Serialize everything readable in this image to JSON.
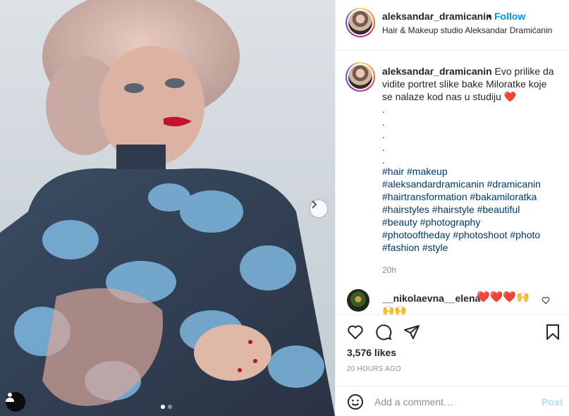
{
  "post": {
    "username": "aleksandar_dramicanin",
    "separator": "•",
    "follow_label": "Follow",
    "location": "Hair & Makeup studio Aleksandar Dramićanin",
    "caption_username": "aleksandar_dramicanin",
    "caption_text": "Evo prilike da vidite portret slike bake Miloratke koje se nalaze kod nas u studiju ❤️",
    "caption_dots": [
      ".",
      ".",
      ".",
      ".",
      "."
    ],
    "hashtags": [
      "#hair #makeup",
      "#aleksandardramicanin #dramicanin",
      "#hairtransformation #bakamiloratka",
      "#hairstyles #hairstyle #beautiful",
      "#beauty #photography",
      "#photooftheday #photoshoot #photo",
      "#fashion #style"
    ],
    "caption_time": "20h",
    "likes": "3,576 likes",
    "posted": "20 HOURS AGO"
  },
  "comment": {
    "username": "__nikolaevna__elena",
    "emojis_line1": "❤️❤️❤️🙌",
    "emojis_line2": "🙌🙌"
  },
  "composer": {
    "placeholder": "Add a comment…",
    "post_label": "Post"
  },
  "icons": [
    "next-arrow-icon",
    "user-tag-icon",
    "heart-icon",
    "comment-icon",
    "share-icon",
    "bookmark-icon",
    "emoji-icon"
  ],
  "carousel": {
    "count": 2,
    "active": 1
  },
  "colors": {
    "link": "#0095f6",
    "hashtag": "#00376b",
    "muted": "#8e8e8e",
    "post_disabled": "#b2dffc"
  }
}
